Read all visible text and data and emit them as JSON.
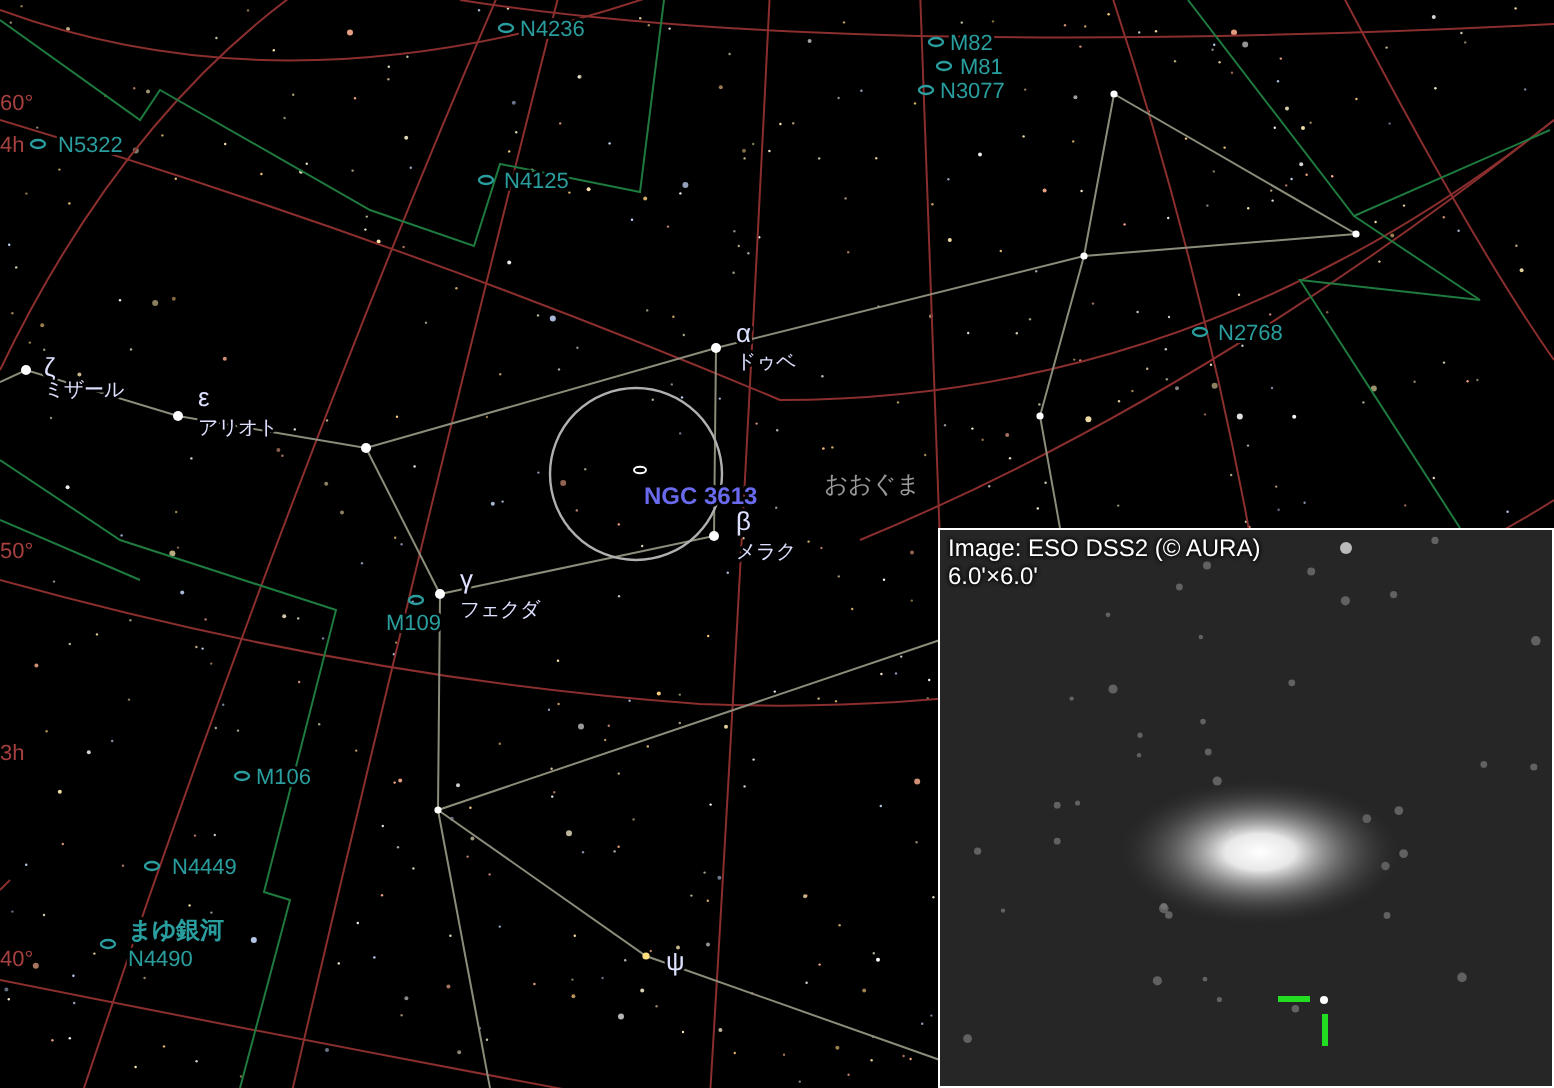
{
  "star_chart": {
    "grid_labels": [
      {
        "text": "60°"
      },
      {
        "text": "4h"
      },
      {
        "text": "50°"
      },
      {
        "text": "3h"
      },
      {
        "text": "40°"
      }
    ],
    "deep_sky_objects": [
      {
        "label": "N4236"
      },
      {
        "label": "M82"
      },
      {
        "label": "M81"
      },
      {
        "label": "N3077"
      },
      {
        "label": "N5322"
      },
      {
        "label": "N4125"
      },
      {
        "label": "N2768"
      },
      {
        "label": "M109"
      },
      {
        "label": "M106"
      },
      {
        "label": "N4449"
      },
      {
        "label": "N4490",
        "common_name": "まゆ銀河"
      }
    ],
    "named_stars": [
      {
        "greek": "ζ",
        "name": "ミザール"
      },
      {
        "greek": "ε",
        "name": "アリオト"
      },
      {
        "greek": "α",
        "name": "ドゥベ"
      },
      {
        "greek": "β",
        "name": "メラク"
      },
      {
        "greek": "γ",
        "name": "フェクダ"
      },
      {
        "greek": "ψ"
      }
    ],
    "constellation": "おおぐま",
    "target": {
      "label": "NGC 3613"
    }
  },
  "image_inset": {
    "credit": "Image: ESO DSS2 (© AURA)",
    "field_size": "6.0'×6.0'"
  }
}
